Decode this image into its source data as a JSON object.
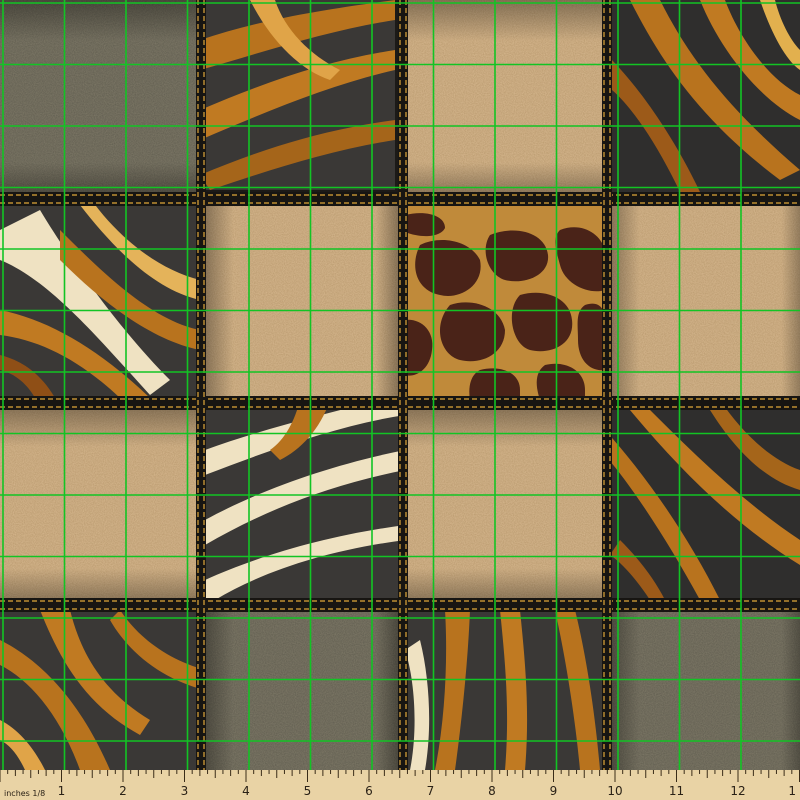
{
  "swatch": {
    "pattern_colors": {
      "burlap_light": "#d2b38a",
      "burlap_dark": "#7a7564",
      "stitch": "#e0a83a",
      "band_dark": "#171512",
      "zebra_dark": "#3a3836",
      "tiger_orange": "#b8731e",
      "cream": "#efe2c2",
      "giraffe_brown": "#4a2318",
      "giraffe_tan": "#c08a3a"
    },
    "grid_color": "#12c424"
  },
  "ruler": {
    "unit_label": "inches 1/8",
    "ticks": [
      "1",
      "2",
      "3",
      "4",
      "5",
      "6",
      "7",
      "8",
      "9",
      "10",
      "11",
      "12",
      "1"
    ],
    "background": "#e9d3a5"
  }
}
